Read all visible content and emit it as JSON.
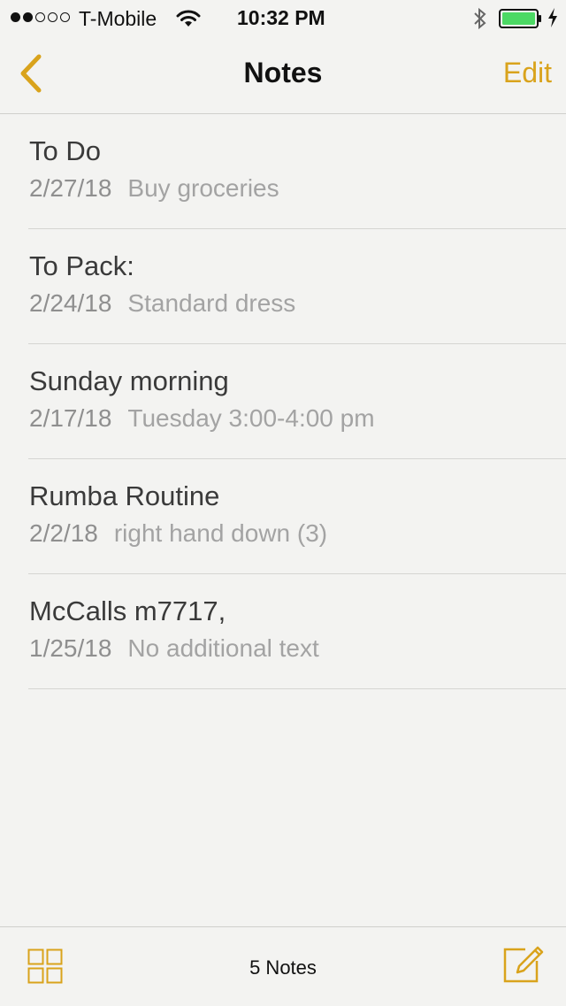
{
  "status_bar": {
    "carrier": "T-Mobile",
    "time": "10:32 PM",
    "signal_bars_filled": 2,
    "signal_bars_total": 5,
    "battery_level": 1.0,
    "battery_color": "#4cd964",
    "icons": [
      "wifi-icon",
      "bluetooth-icon",
      "battery-icon",
      "charging-icon"
    ]
  },
  "nav": {
    "title": "Notes",
    "edit_label": "Edit",
    "back_icon": "chevron-left-icon"
  },
  "notes": [
    {
      "title": "To Do",
      "date": "2/27/18",
      "preview": "Buy groceries"
    },
    {
      "title": "To Pack:",
      "date": "2/24/18",
      "preview": "Standard dress"
    },
    {
      "title": "Sunday morning",
      "date": "2/17/18",
      "preview": "Tuesday 3:00-4:00 pm"
    },
    {
      "title": "Rumba Routine",
      "date": "2/2/18",
      "preview": "right hand down (3)"
    },
    {
      "title": "McCalls m7717,",
      "date": "1/25/18",
      "preview": "No additional text"
    }
  ],
  "toolbar": {
    "count_label": "5 Notes",
    "left_icon": "grid-icon",
    "right_icon": "compose-icon"
  },
  "colors": {
    "accent": "#d9a31c",
    "background": "#f3f3f1"
  }
}
